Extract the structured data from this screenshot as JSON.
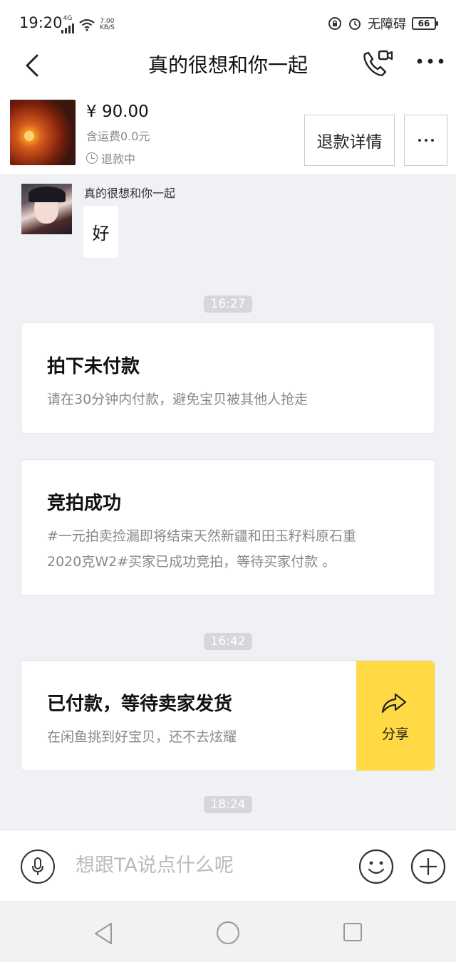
{
  "status_bar": {
    "time": "19:20",
    "network": "4G",
    "speed_value": "7.00",
    "speed_unit": "KB/S",
    "accessibility_label": "无障碍",
    "battery": "66"
  },
  "header": {
    "title": "真的很想和你一起"
  },
  "product": {
    "price": "¥ 90.00",
    "shipping": "含运费0.0元",
    "status": "退款中",
    "refund_button": "退款详情"
  },
  "messages": {
    "sender_name": "真的很想和你一起",
    "text": "好"
  },
  "timestamps": [
    "16:27",
    "16:42",
    "18:24"
  ],
  "cards": [
    {
      "title": "拍下未付款",
      "description": "请在30分钟内付款，避免宝贝被其他人抢走"
    },
    {
      "title": "竞拍成功",
      "description_line1": "#一元拍卖捡漏即将结束天然新疆和田玉籽料原石重",
      "description_line2": "2020克W2#买家已成功竞拍，等待买家付款 。"
    },
    {
      "title": "已付款，等待卖家发货",
      "description": "在闲鱼挑到好宝贝，还不去炫耀",
      "share_label": "分享"
    }
  ],
  "input": {
    "placeholder": "想跟TA说点什么呢"
  },
  "colors": {
    "accent": "#ffda44",
    "background": "#f0f1f5",
    "time_pill": "#d6d7db"
  }
}
